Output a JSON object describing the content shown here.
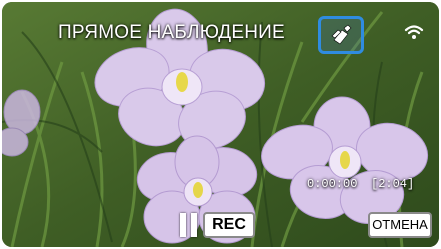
{
  "header": {
    "title": "ПРЯМОЕ НАБЛЮДЕНИЕ",
    "nfc_icon": "nfc-icon",
    "wifi_icon": "wifi-signal-icon"
  },
  "status": {
    "elapsed_time": "0:00:00",
    "remaining_time": "[2:04]"
  },
  "controls": {
    "pause_icon": "pause-icon",
    "rec_label": "REC",
    "cancel_label": "ОТМЕНА"
  },
  "colors": {
    "accent": "#2f8ce0",
    "button_bg": "#ffffff"
  }
}
